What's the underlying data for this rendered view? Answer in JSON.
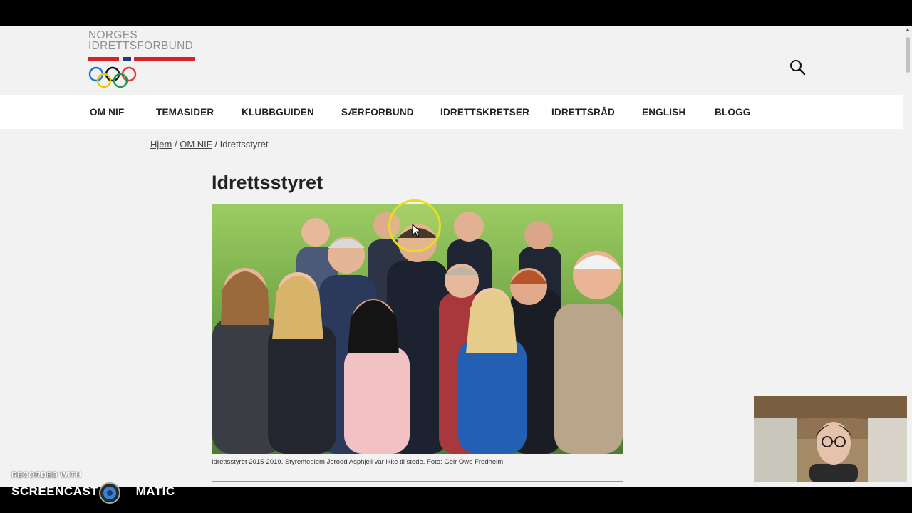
{
  "logo": {
    "line1": "NORGES",
    "line2": "IDRETTSFORBUND",
    "colors": {
      "red": "#d8232a",
      "blue": "#1e3c78",
      "grey": "#8a8f94"
    }
  },
  "search": {
    "placeholder": ""
  },
  "nav": {
    "items": [
      "OM NIF",
      "TEMASIDER",
      "KLUBBGUIDEN",
      "SÆRFORBUND",
      "IDRETTSKRETSER",
      "IDRETTSRÅD",
      "ENGLISH",
      "BLOGG"
    ]
  },
  "breadcrumb": {
    "home": "Hjem",
    "sep": "/",
    "parent": "OM NIF",
    "current": "Idrettsstyret"
  },
  "page": {
    "title": "Idrettsstyret",
    "image_caption": "Idrettsstyret 2015-2019. Styremedlem Jorodd Asphjell var ikke til stede. Foto: Geir Owe Fredheim"
  },
  "watermark": {
    "recorded_with": "RECORDED WITH",
    "brand_left": "SCREENCAST",
    "brand_right": "MATIC"
  }
}
